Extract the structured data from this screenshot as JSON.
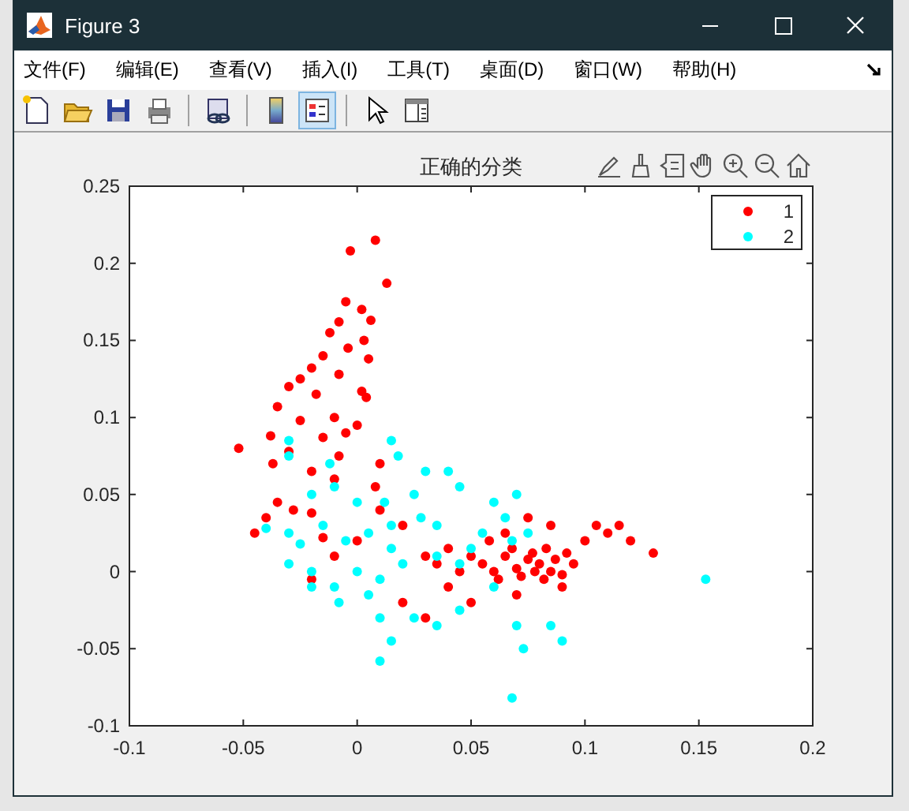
{
  "window": {
    "title": "Figure 3"
  },
  "menu": [
    "文件(F)",
    "编辑(E)",
    "查看(V)",
    "插入(I)",
    "工具(T)",
    "桌面(D)",
    "窗口(W)",
    "帮助(H)"
  ],
  "toolbar": [
    {
      "kind": "new",
      "pressed": false
    },
    {
      "kind": "open",
      "pressed": false
    },
    {
      "kind": "save",
      "pressed": false
    },
    {
      "kind": "print",
      "pressed": false
    },
    {
      "kind": "sep"
    },
    {
      "kind": "link",
      "pressed": false
    },
    {
      "kind": "sep"
    },
    {
      "kind": "colorbar",
      "pressed": false
    },
    {
      "kind": "legend",
      "pressed": true
    },
    {
      "kind": "sep"
    },
    {
      "kind": "pointer",
      "pressed": false
    },
    {
      "kind": "inspector",
      "pressed": false
    }
  ],
  "axes_toolbar": [
    {
      "kind": "annotate"
    },
    {
      "kind": "brush"
    },
    {
      "kind": "datatip"
    },
    {
      "kind": "pan"
    },
    {
      "kind": "zoomin"
    },
    {
      "kind": "zoomout"
    },
    {
      "kind": "home"
    }
  ],
  "chart_data": {
    "type": "scatter",
    "title": "正确的分类",
    "legend": true,
    "xlim": [
      -0.1,
      0.2
    ],
    "ylim": [
      -0.1,
      0.25
    ],
    "xticks": [
      {
        "value": -0.1,
        "label": "-0.1"
      },
      {
        "value": -0.05,
        "label": "-0.05"
      },
      {
        "value": 0,
        "label": "0"
      },
      {
        "value": 0.05,
        "label": "0.05"
      },
      {
        "value": 0.1,
        "label": "0.1"
      },
      {
        "value": 0.15,
        "label": "0.15"
      },
      {
        "value": 0.2,
        "label": "0.2"
      }
    ],
    "yticks": [
      {
        "value": -0.1,
        "label": "-0.1"
      },
      {
        "value": -0.05,
        "label": "-0.05"
      },
      {
        "value": 0,
        "label": "0"
      },
      {
        "value": 0.05,
        "label": "0.05"
      },
      {
        "value": 0.1,
        "label": "0.1"
      },
      {
        "value": 0.15,
        "label": "0.15"
      },
      {
        "value": 0.2,
        "label": "0.2"
      },
      {
        "value": 0.25,
        "label": "0.25"
      }
    ],
    "series": [
      {
        "name": "1",
        "color": "#ff0000",
        "x": [
          0.008,
          -0.003,
          0.013,
          -0.005,
          0.002,
          -0.008,
          0.006,
          -0.012,
          0.003,
          -0.004,
          -0.015,
          0.005,
          -0.02,
          -0.008,
          -0.025,
          -0.03,
          0.002,
          -0.018,
          0.004,
          -0.035,
          -0.01,
          -0.025,
          0.0,
          -0.005,
          -0.038,
          -0.015,
          -0.052,
          -0.03,
          -0.008,
          0.01,
          -0.037,
          -0.02,
          -0.01,
          0.008,
          -0.035,
          -0.028,
          -0.04,
          0.01,
          -0.02,
          0.02,
          -0.045,
          -0.015,
          0.03,
          0.035,
          0.04,
          0.045,
          0.05,
          0.055,
          0.058,
          0.06,
          0.062,
          0.065,
          0.068,
          0.07,
          0.072,
          0.075,
          0.077,
          0.078,
          0.08,
          0.082,
          0.083,
          0.085,
          0.087,
          0.09,
          0.092,
          0.095,
          0.1,
          0.105,
          0.11,
          0.115,
          0.12,
          0.13,
          0.085,
          0.075,
          0.065,
          0.04,
          0.05,
          0.03,
          0.02,
          0.07,
          0.09,
          -0.01,
          -0.02,
          0.0
        ],
        "values": [
          0.215,
          0.208,
          0.187,
          0.175,
          0.17,
          0.162,
          0.163,
          0.155,
          0.15,
          0.145,
          0.14,
          0.138,
          0.132,
          0.128,
          0.125,
          0.12,
          0.117,
          0.115,
          0.113,
          0.107,
          0.1,
          0.098,
          0.095,
          0.09,
          0.088,
          0.087,
          0.08,
          0.078,
          0.075,
          0.07,
          0.07,
          0.065,
          0.06,
          0.055,
          0.045,
          0.04,
          0.035,
          0.04,
          0.038,
          0.03,
          0.025,
          0.022,
          0.01,
          0.005,
          0.015,
          0.0,
          0.01,
          0.005,
          0.02,
          0.0,
          -0.005,
          0.01,
          0.015,
          0.002,
          -0.003,
          0.008,
          0.012,
          0.0,
          0.005,
          -0.005,
          0.015,
          0.0,
          0.008,
          -0.002,
          0.012,
          0.005,
          0.02,
          0.03,
          0.025,
          0.03,
          0.02,
          0.012,
          0.03,
          0.035,
          0.025,
          -0.01,
          -0.02,
          -0.03,
          -0.02,
          -0.015,
          -0.01,
          0.01,
          -0.005,
          0.02
        ]
      },
      {
        "name": "2",
        "color": "#00ffff",
        "x": [
          -0.03,
          -0.03,
          -0.012,
          0.015,
          0.018,
          -0.01,
          -0.02,
          0.0,
          0.012,
          0.025,
          0.03,
          0.04,
          0.045,
          0.028,
          0.035,
          -0.04,
          -0.03,
          -0.025,
          -0.015,
          -0.005,
          0.005,
          0.015,
          0.02,
          0.01,
          0.0,
          -0.01,
          -0.02,
          -0.008,
          0.005,
          0.01,
          0.015,
          0.01,
          0.025,
          0.035,
          0.045,
          0.05,
          0.055,
          0.06,
          0.065,
          0.07,
          0.068,
          0.075,
          0.06,
          0.07,
          0.073,
          0.085,
          0.09,
          0.068,
          0.153,
          -0.03,
          -0.02,
          0.015,
          0.035,
          0.045
        ],
        "values": [
          0.085,
          0.075,
          0.07,
          0.085,
          0.075,
          0.055,
          0.05,
          0.045,
          0.045,
          0.05,
          0.065,
          0.065,
          0.055,
          0.035,
          0.03,
          0.028,
          0.025,
          0.018,
          0.03,
          0.02,
          0.025,
          0.015,
          0.005,
          -0.005,
          0.0,
          -0.01,
          -0.01,
          -0.02,
          -0.015,
          -0.03,
          -0.045,
          -0.058,
          -0.03,
          -0.035,
          -0.025,
          0.015,
          0.025,
          0.045,
          0.035,
          0.05,
          0.02,
          0.025,
          -0.01,
          -0.035,
          -0.05,
          -0.035,
          -0.045,
          -0.082,
          -0.005,
          0.005,
          0.0,
          0.03,
          0.01,
          0.005
        ]
      }
    ]
  }
}
